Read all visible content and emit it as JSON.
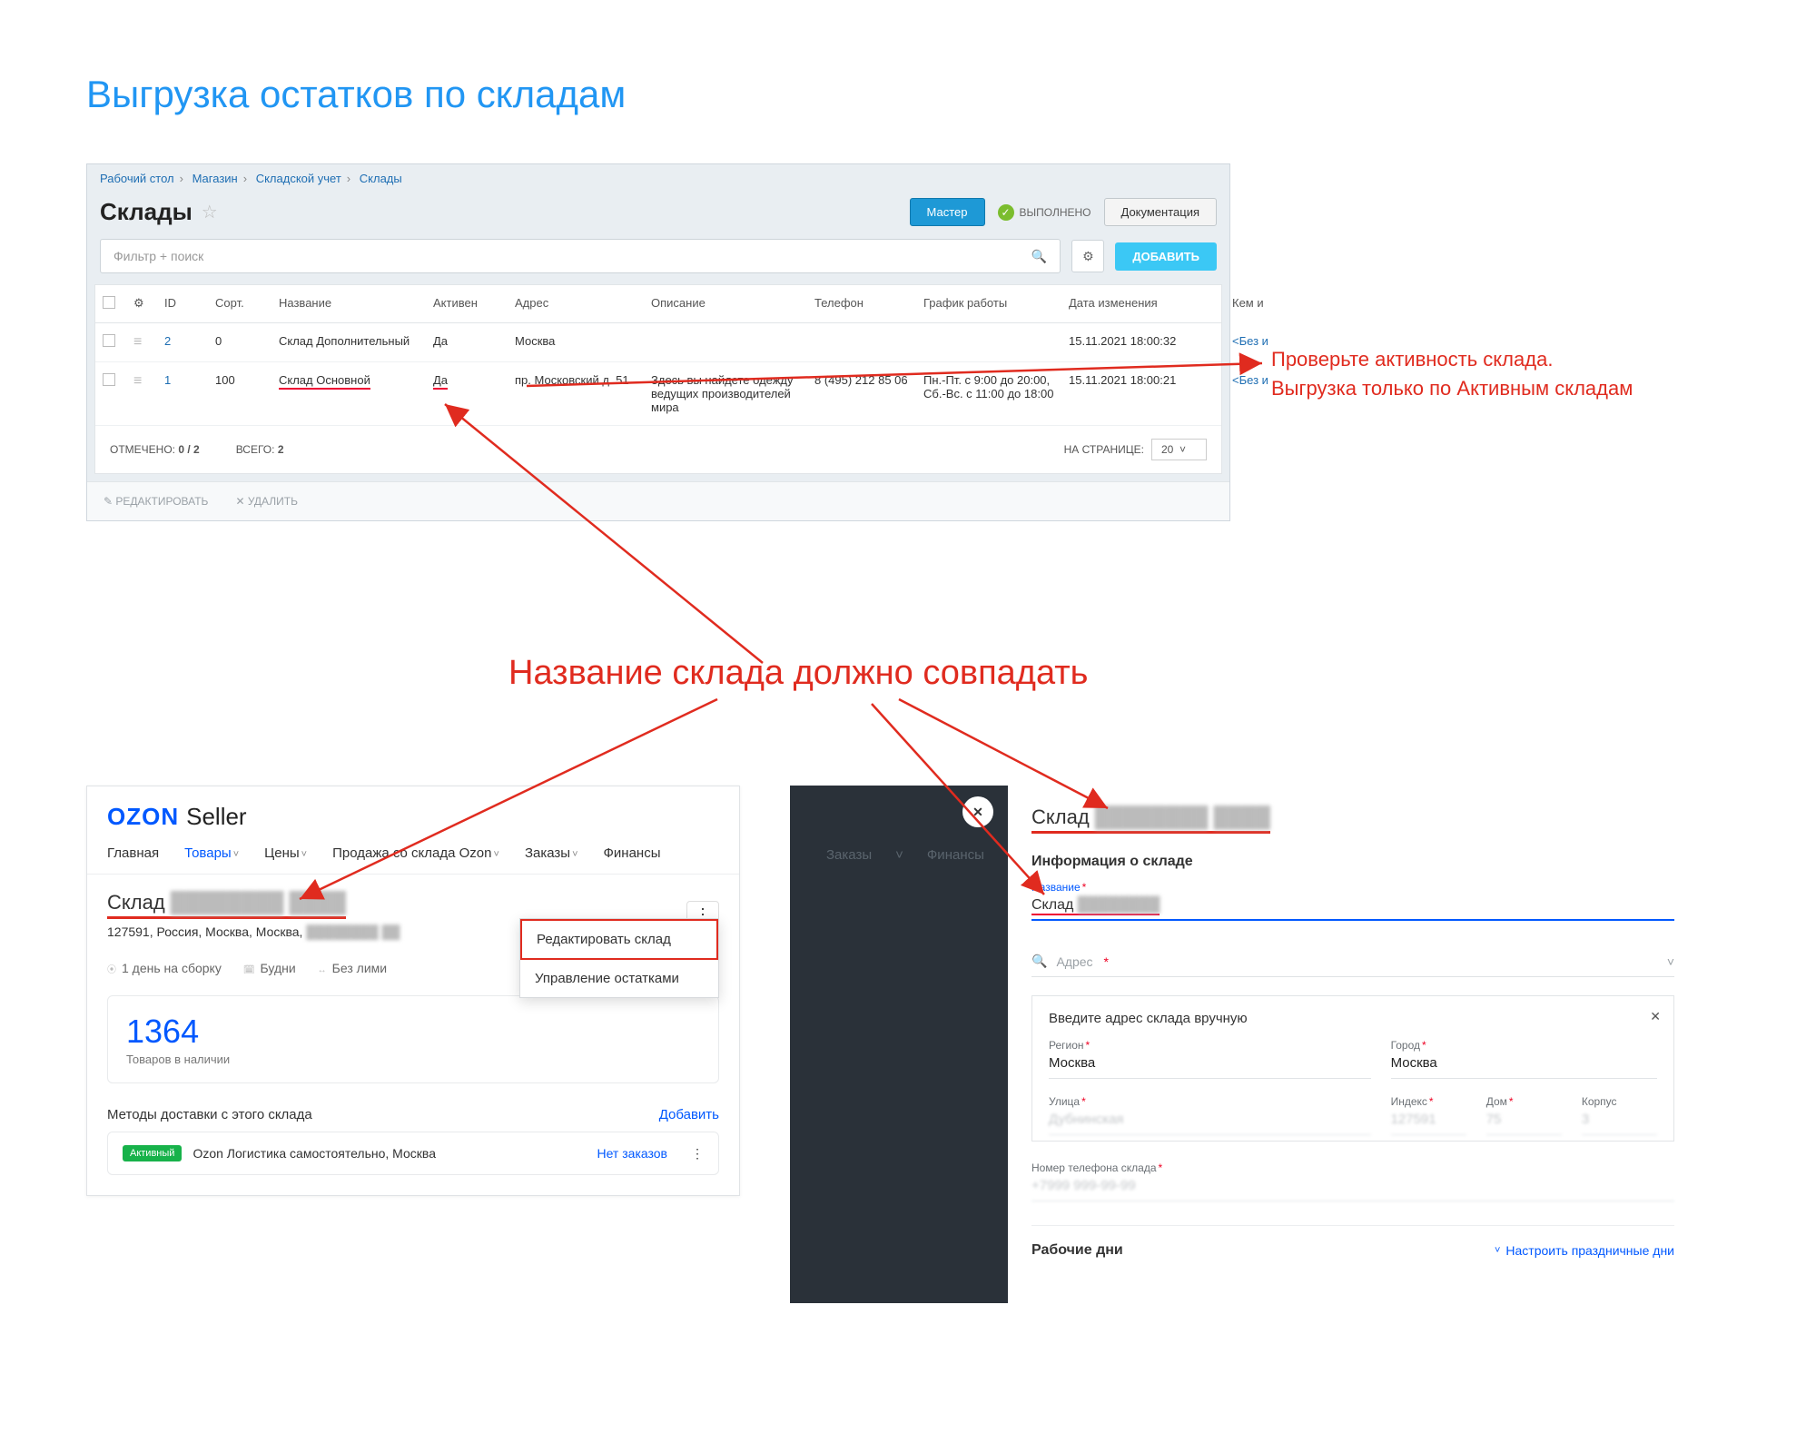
{
  "page_title": "Выгрузка остатков по складам",
  "toppanel": {
    "breadcrumbs": [
      "Рабочий стол",
      "Магазин",
      "Складской учет",
      "Склады"
    ],
    "heading": "Склады",
    "master_btn": "Мастер",
    "done_badge": "ВЫПОЛНЕНО",
    "doc_btn": "Документация",
    "filter_placeholder": "Фильтр + поиск",
    "add_btn": "ДОБАВИТЬ",
    "columns": [
      "",
      "",
      "ID",
      "Сорт.",
      "Название",
      "Активен",
      "Адрес",
      "Описание",
      "Телефон",
      "График работы",
      "Дата изменения",
      "Кем и"
    ],
    "rows": [
      {
        "id": "2",
        "sort": "0",
        "name": "Склад Дополнительный",
        "active": "Да",
        "addr": "Москва",
        "descr": "",
        "phone": "",
        "schedule": "",
        "changed": "15.11.2021 18:00:32",
        "who": "<Без и"
      },
      {
        "id": "1",
        "sort": "100",
        "name": "Склад Основной",
        "active": "Да",
        "addr": "пр. Московский д. 51",
        "descr": "Здесь вы найдете одежду ведущих производителей мира",
        "phone": "8 (495) 212 85 06",
        "schedule": "Пн.-Пт. с 9:00 до 20:00, Сб.-Вс. с 11:00 до 18:00",
        "changed": "15.11.2021 18:00:21",
        "who": "<Без и"
      }
    ],
    "foot_marked_label": "ОТМЕЧЕНО:",
    "foot_marked_val": "0 / 2",
    "foot_total_label": "ВСЕГО:",
    "foot_total_val": "2",
    "foot_perpage_label": "НА СТРАНИЦЕ:",
    "foot_perpage_val": "20",
    "action_edit": "РЕДАКТИРОВАТЬ",
    "action_delete": "УДАЛИТЬ"
  },
  "annot_right_l1": "Проверьте активность склада.",
  "annot_right_l2": "Выгрузка только по Активным складам",
  "center_heading": "Название склада должно совпадать",
  "ozon": {
    "brand_a": "OZON",
    "brand_b": "Seller",
    "nav": [
      "Главная",
      "Товары",
      "Цены",
      "Продажа со склада Ozon",
      "Заказы",
      "Финансы"
    ],
    "wh_prefix": "Склад",
    "addr": "127591, Россия, Москва, Москва,",
    "menu_edit": "Редактировать склад",
    "menu_stock": "Управление остатками",
    "meta_assembly": "1 день на сборку",
    "meta_days": "Будни",
    "meta_limit": "Без лими",
    "count": "1364",
    "count_caption": "Товаров в наличии",
    "deliv_title": "Методы доставки с этого склада",
    "deliv_add": "Добавить",
    "deliv_badge": "Активный",
    "deliv_name": "Ozon Логистика самостоятельно, Москва",
    "deliv_noorders": "Нет заказов"
  },
  "modal": {
    "bg_tabs": [
      "Заказы",
      "Финансы"
    ],
    "h_prefix": "Склад",
    "section_info": "Информация о складе",
    "label_name": "Название",
    "val_name_prefix": "Склад",
    "addr_placeholder": "Адрес",
    "manual_title": "Введите адрес склада вручную",
    "f_region_l": "Регион",
    "f_region_v": "Москва",
    "f_city_l": "Город",
    "f_city_v": "Москва",
    "f_street_l": "Улица",
    "f_street_v": "Дубнинская",
    "f_index_l": "Индекс",
    "f_index_v": "127591",
    "f_house_l": "Дом",
    "f_house_v": "75",
    "f_korpus_l": "Корпус",
    "f_korpus_v": "3",
    "phone_l": "Номер телефона склада",
    "phone_v": "+7999 999-99-99",
    "workdays": "Рабочие дни",
    "holidays": "Настроить праздничные дни"
  }
}
